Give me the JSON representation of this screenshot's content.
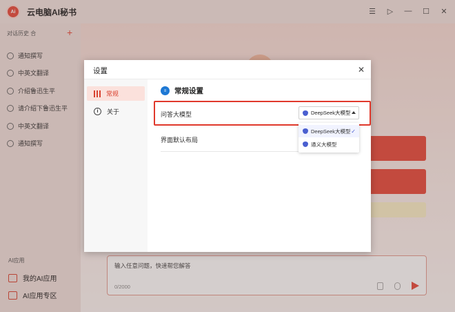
{
  "app": {
    "title": "云电脑AI秘书",
    "logo_text": "Ai"
  },
  "sidebar": {
    "history_label": "对话历史 合",
    "add_symbol": "+",
    "items": [
      {
        "label": "通知撰写"
      },
      {
        "label": "中英文翻译"
      },
      {
        "label": "介绍鲁迅生平"
      },
      {
        "label": "请介绍下鲁迅生平"
      },
      {
        "label": "中英文翻译"
      },
      {
        "label": "通知撰写"
      }
    ],
    "ai_section_label": "AI应用",
    "my_apps_label": "我的AI应用",
    "app_zone_label": "AI应用专区"
  },
  "composer": {
    "placeholder": "输入任意问题，快速帮您解答",
    "count": "0/2000"
  },
  "settings": {
    "title": "设置",
    "close_symbol": "✕",
    "nav": [
      {
        "label": "常规",
        "active": true
      },
      {
        "label": "关于",
        "active": false
      }
    ],
    "section_title": "常规设置",
    "model_label": "问答大模型",
    "layout_label": "界面默认布局",
    "selected_model": "DeepSeek大模型",
    "options": [
      {
        "label": "DeepSeek大模型",
        "selected": true
      },
      {
        "label": "通义大模型",
        "selected": false
      }
    ]
  },
  "colors": {
    "accent": "#e8483a",
    "highlight_border": "#e0382b",
    "model_icon": "#4a5fd0"
  }
}
